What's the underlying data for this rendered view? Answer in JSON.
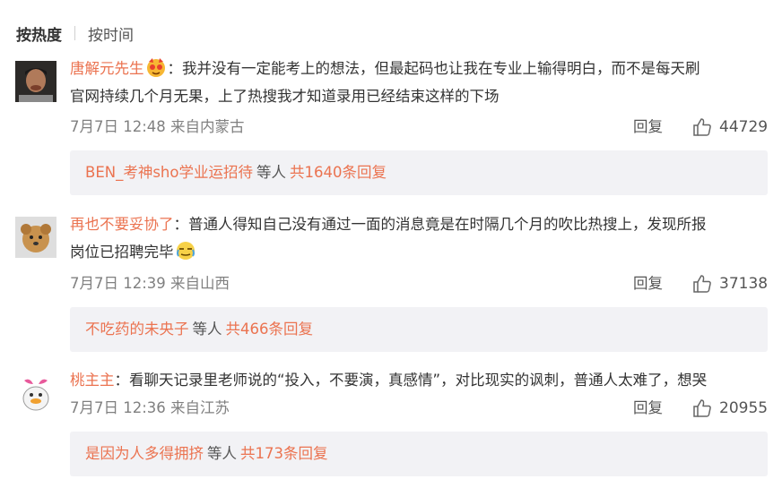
{
  "sort": {
    "active": "按热度",
    "other": "按时间"
  },
  "comments": [
    {
      "user": "唐解元先生",
      "text_line1": "：我并没有一定能考上的想法，但最起码也让我在专业上输得明白，而不是每天刷",
      "text_line2": "官网持续几个月无果，上了热搜我才知道录用已经结束这样的下场",
      "meta": "7月7日 12:48 来自内蒙古",
      "reply_label": "回复",
      "likes": "44729",
      "reply_user": "BEN_考神sho学业运招待",
      "reply_mid": "等人",
      "reply_count": "共1640条回复"
    },
    {
      "user": "再也不要妥协了",
      "text_line1": "：普通人得知自己没有通过一面的消息竟是在时隔几个月的吹比热搜上，发现所报",
      "text_line2": "岗位已招聘完毕",
      "meta": "7月7日 12:39 来自山西",
      "reply_label": "回复",
      "likes": "37138",
      "reply_user": "不吃药的未央子",
      "reply_mid": "等人",
      "reply_count": "共466条回复"
    },
    {
      "user": "桃主主",
      "text_line1": "：看聊天记录里老师说的“投入，不要演，真感情”，对比现实的讽刺，普通人太难了，想哭",
      "meta": "7月7日 12:36 来自江苏",
      "reply_label": "回复",
      "likes": "20955",
      "reply_user": "是因为人多得拥挤",
      "reply_mid": "等人",
      "reply_count": "共173条回复"
    }
  ],
  "colors": {
    "username": "#eb7350",
    "meta": "#808080",
    "reply_bg": "#f2f2f5"
  }
}
